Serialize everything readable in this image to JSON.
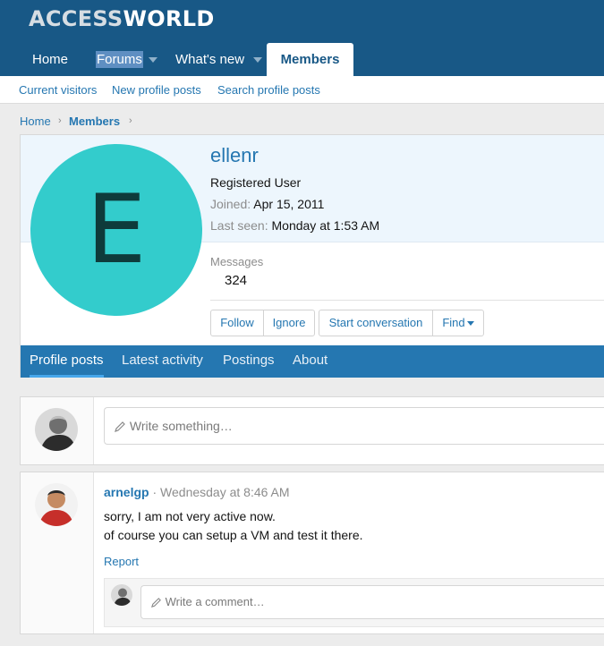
{
  "site": {
    "logo_part1": "ACCESS",
    "logo_part2": "WORLD"
  },
  "nav": {
    "home": "Home",
    "forums": "Forums",
    "whats_new": "What's new",
    "members": "Members"
  },
  "subnav": {
    "current_visitors": "Current visitors",
    "new_profile_posts": "New profile posts",
    "search_profile_posts": "Search profile posts"
  },
  "breadcrumb": {
    "home": "Home",
    "members": "Members",
    "sep": "›"
  },
  "profile": {
    "avatar_letter": "E",
    "avatar_color": "#33cccc",
    "username": "ellenr",
    "user_title": "Registered User",
    "joined_label": "Joined:",
    "joined_value": "Apr 15, 2011",
    "last_seen_label": "Last seen:",
    "last_seen_value": "Monday at 1:53 AM",
    "messages_label": "Messages",
    "messages_value": "324",
    "buttons": {
      "follow": "Follow",
      "ignore": "Ignore",
      "start_conversation": "Start conversation",
      "find": "Find"
    }
  },
  "profile_tabs": {
    "profile_posts": "Profile posts",
    "latest_activity": "Latest activity",
    "postings": "Postings",
    "about": "About"
  },
  "composer": {
    "placeholder": "Write something…"
  },
  "post": {
    "author": "arnelgp",
    "separator": "·",
    "time": "Wednesday at 8:46 AM",
    "lines": [
      "sorry, I am not very active now.",
      "of course you can setup a VM and test it there."
    ],
    "report": "Report",
    "comment_placeholder": "Write a comment…"
  },
  "colors": {
    "header": "#185886",
    "accent": "#2577b1",
    "tab_underline": "#47a7eb"
  }
}
